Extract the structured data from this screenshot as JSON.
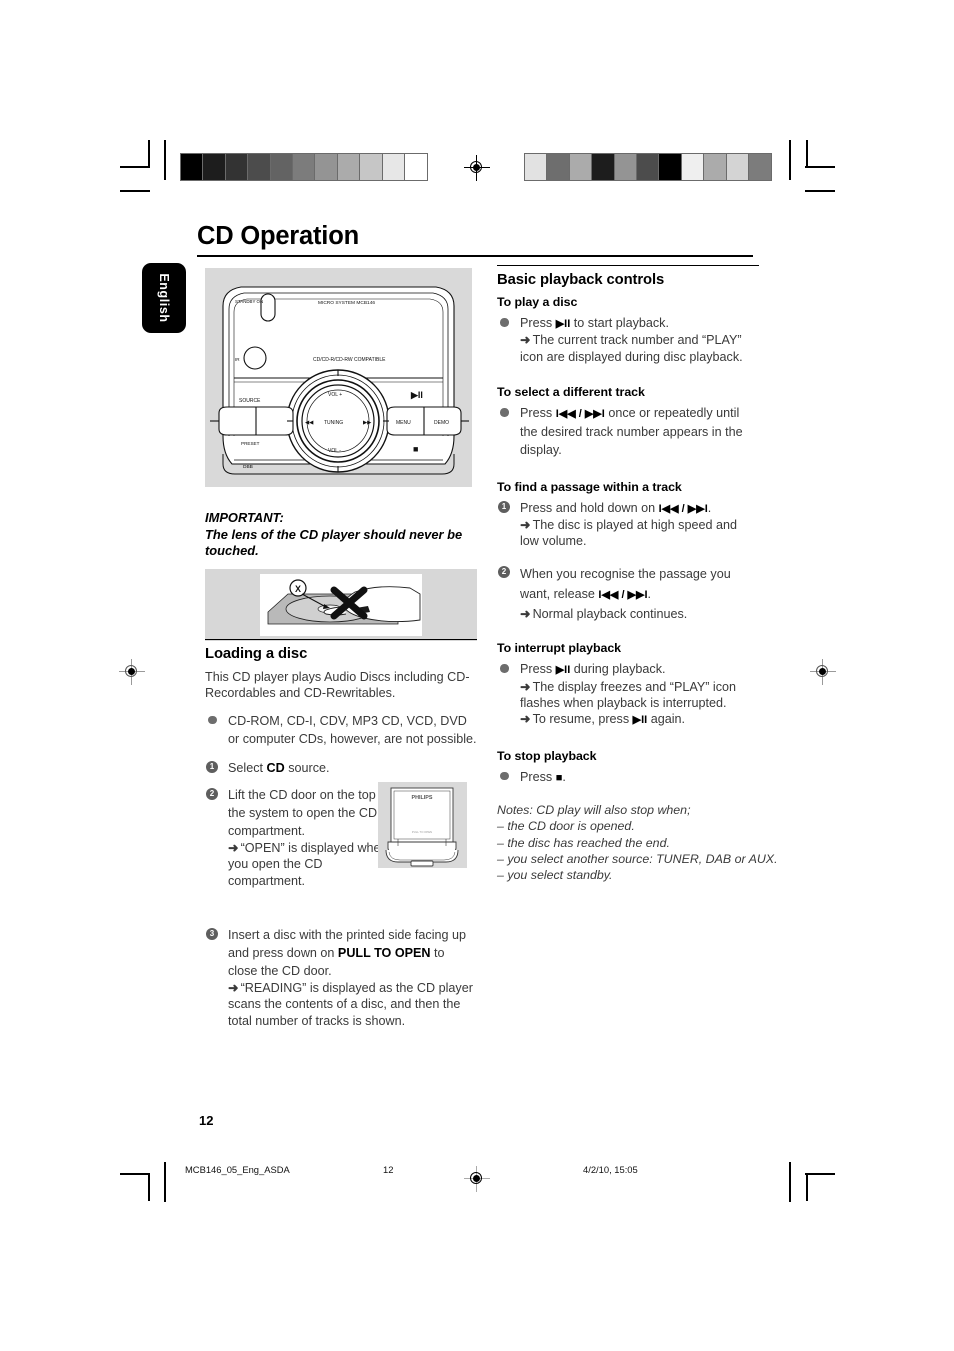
{
  "page": {
    "title": "CD Operation",
    "language_tab": "English",
    "page_number": "12"
  },
  "footer": {
    "file_name": "MCB146_05_Eng_ASDA",
    "page_number": "12",
    "timestamp": "4/2/10, 15:05"
  },
  "calibration": {
    "left_strip": [
      "#000000",
      "#1d1d1d",
      "#333333",
      "#4c4c4c",
      "#636363",
      "#7c7c7c",
      "#949494",
      "#ababab",
      "#c6c6c6",
      "#e7e7e7",
      "#ffffff"
    ],
    "right_strip": [
      "#e2e2e2",
      "#6e6e6e",
      "#ababab",
      "#1d1d1d",
      "#949494",
      "#4c4c4c",
      "#000000",
      "#efefef",
      "#ababab",
      "#d4d4d4",
      "#7c7c7c"
    ]
  },
  "device_illustration": {
    "label_standby": "STANDBY ON",
    "label_model": "MICRO SYSTEM MCB146",
    "label_compat": "CD/CD-R/CD-RW COMPATIBLE",
    "label_ir": "IR",
    "label_source": "SOURCE",
    "label_preset": "PRESET",
    "label_dbb": "DBB",
    "label_vol_up": "VOL +",
    "label_vol_down": "VOL -",
    "label_tuning": "TUNING",
    "label_prev": "◀◀",
    "label_next": "▶▶",
    "label_menu": "MENU",
    "label_demo": "DEMO",
    "label_play_pause": "▶II",
    "label_stop": "■"
  },
  "philips_illustration": {
    "brand": "PHILIPS"
  },
  "lens_illustration": {
    "marker": "X"
  },
  "left_column": {
    "important": {
      "heading": "IMPORTANT:",
      "text": "The lens of the CD player should never be touched."
    },
    "loading": {
      "heading": "Loading a disc",
      "para1": "This CD player plays Audio Discs including CD-Recordables and CD-Rewritables.",
      "bullet1": "CD-ROM, CD-I, CDV, MP3 CD, VCD, DVD or computer CDs, however, are not possible.",
      "step1_pre": "Select ",
      "step1_bold": "CD",
      "step1_post": " source.",
      "step2_text": "Lift the CD door on the top of the system to open the CD compartment.",
      "step2_result": "“OPEN” is displayed when you open the CD compartment.",
      "step3_pre": "Insert a disc with the printed side facing up and press down on ",
      "step3_bold": "PULL TO OPEN",
      "step3_post": " to close the CD door.",
      "step3_result": "“READING” is displayed as the CD player scans the contents of a disc, and then the total number of tracks is shown."
    }
  },
  "right_column": {
    "heading": "Basic playback controls",
    "play_disc": {
      "heading": "To play a disc",
      "press_pre": "Press ",
      "press_glyph": "▶II",
      "press_post": " to start playback.",
      "result": "The current track number and “PLAY” icon are displayed during disc playback."
    },
    "select_track": {
      "heading": "To select a different track",
      "press_pre": "Press ",
      "press_glyph": "I◀◀ / ▶▶I",
      "press_post": " once or repeatedly until the desired track number appears in the display."
    },
    "find_passage": {
      "heading": "To find a passage within a track",
      "step1_pre": "Press and hold down on ",
      "step1_glyph": "I◀◀ / ▶▶I",
      "step1_post": ".",
      "step1_result": "The disc is played at high speed and low volume.",
      "step2_pre": "When you recognise the passage you want, release ",
      "step2_glyph": "I◀◀ / ▶▶I",
      "step2_post": ".",
      "step2_result": "Normal playback continues."
    },
    "interrupt": {
      "heading": "To interrupt playback",
      "press_pre": "Press ",
      "press_glyph": "▶II",
      "press_post": " during playback.",
      "result1": "The display freezes and “PLAY” icon flashes when playback is interrupted.",
      "result2_pre": "To resume, press ",
      "result2_glyph": "▶II",
      "result2_post": " again."
    },
    "stop": {
      "heading": "To stop playback",
      "press_pre": "Press ",
      "press_glyph": "■",
      "press_post": "."
    },
    "notes": {
      "lead": "Notes: CD play will also stop when;",
      "items": [
        "– the CD door is opened.",
        "– the disc has reached the end.",
        "– you select another source: TUNER, DAB or AUX.",
        "– you select standby."
      ]
    }
  }
}
